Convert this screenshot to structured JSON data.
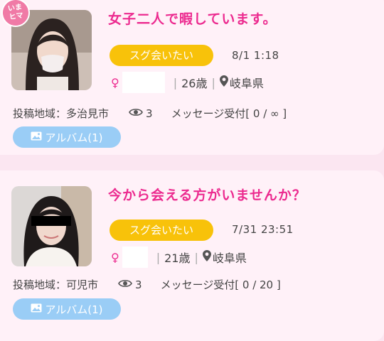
{
  "posts": [
    {
      "badge_line1": "いま",
      "badge_line2": "ヒマ",
      "title": "女子二人で暇しています。",
      "tag": "スグ会いたい",
      "date": "8/1 1:18",
      "gender_symbol": "♀",
      "age": "26歳",
      "prefecture": "岐阜県",
      "region": "投稿地域：多治見市",
      "views": "3",
      "message_status": "メッセージ受付[ 0 / ∞ ]",
      "album": "アルバム(1)"
    },
    {
      "title": "今から会える方がいませんか？",
      "tag": "スグ会いたい",
      "date": "7/31 23:51",
      "gender_symbol": "♀",
      "age": "21歳",
      "prefecture": "岐阜県",
      "region": "投稿地域：可児市",
      "views": "3",
      "message_status": "メッセージ受付[ 0 / 20 ]",
      "album": "アルバム(1)"
    }
  ],
  "colors": {
    "accent_pink": "#ec2a8f",
    "tag_yellow": "#f8c20a",
    "album_blue": "#9acdf6",
    "card_bg": "#fff1f8"
  },
  "icons": [
    "eye-icon",
    "map-pin-icon",
    "image-icon",
    "female-icon"
  ]
}
